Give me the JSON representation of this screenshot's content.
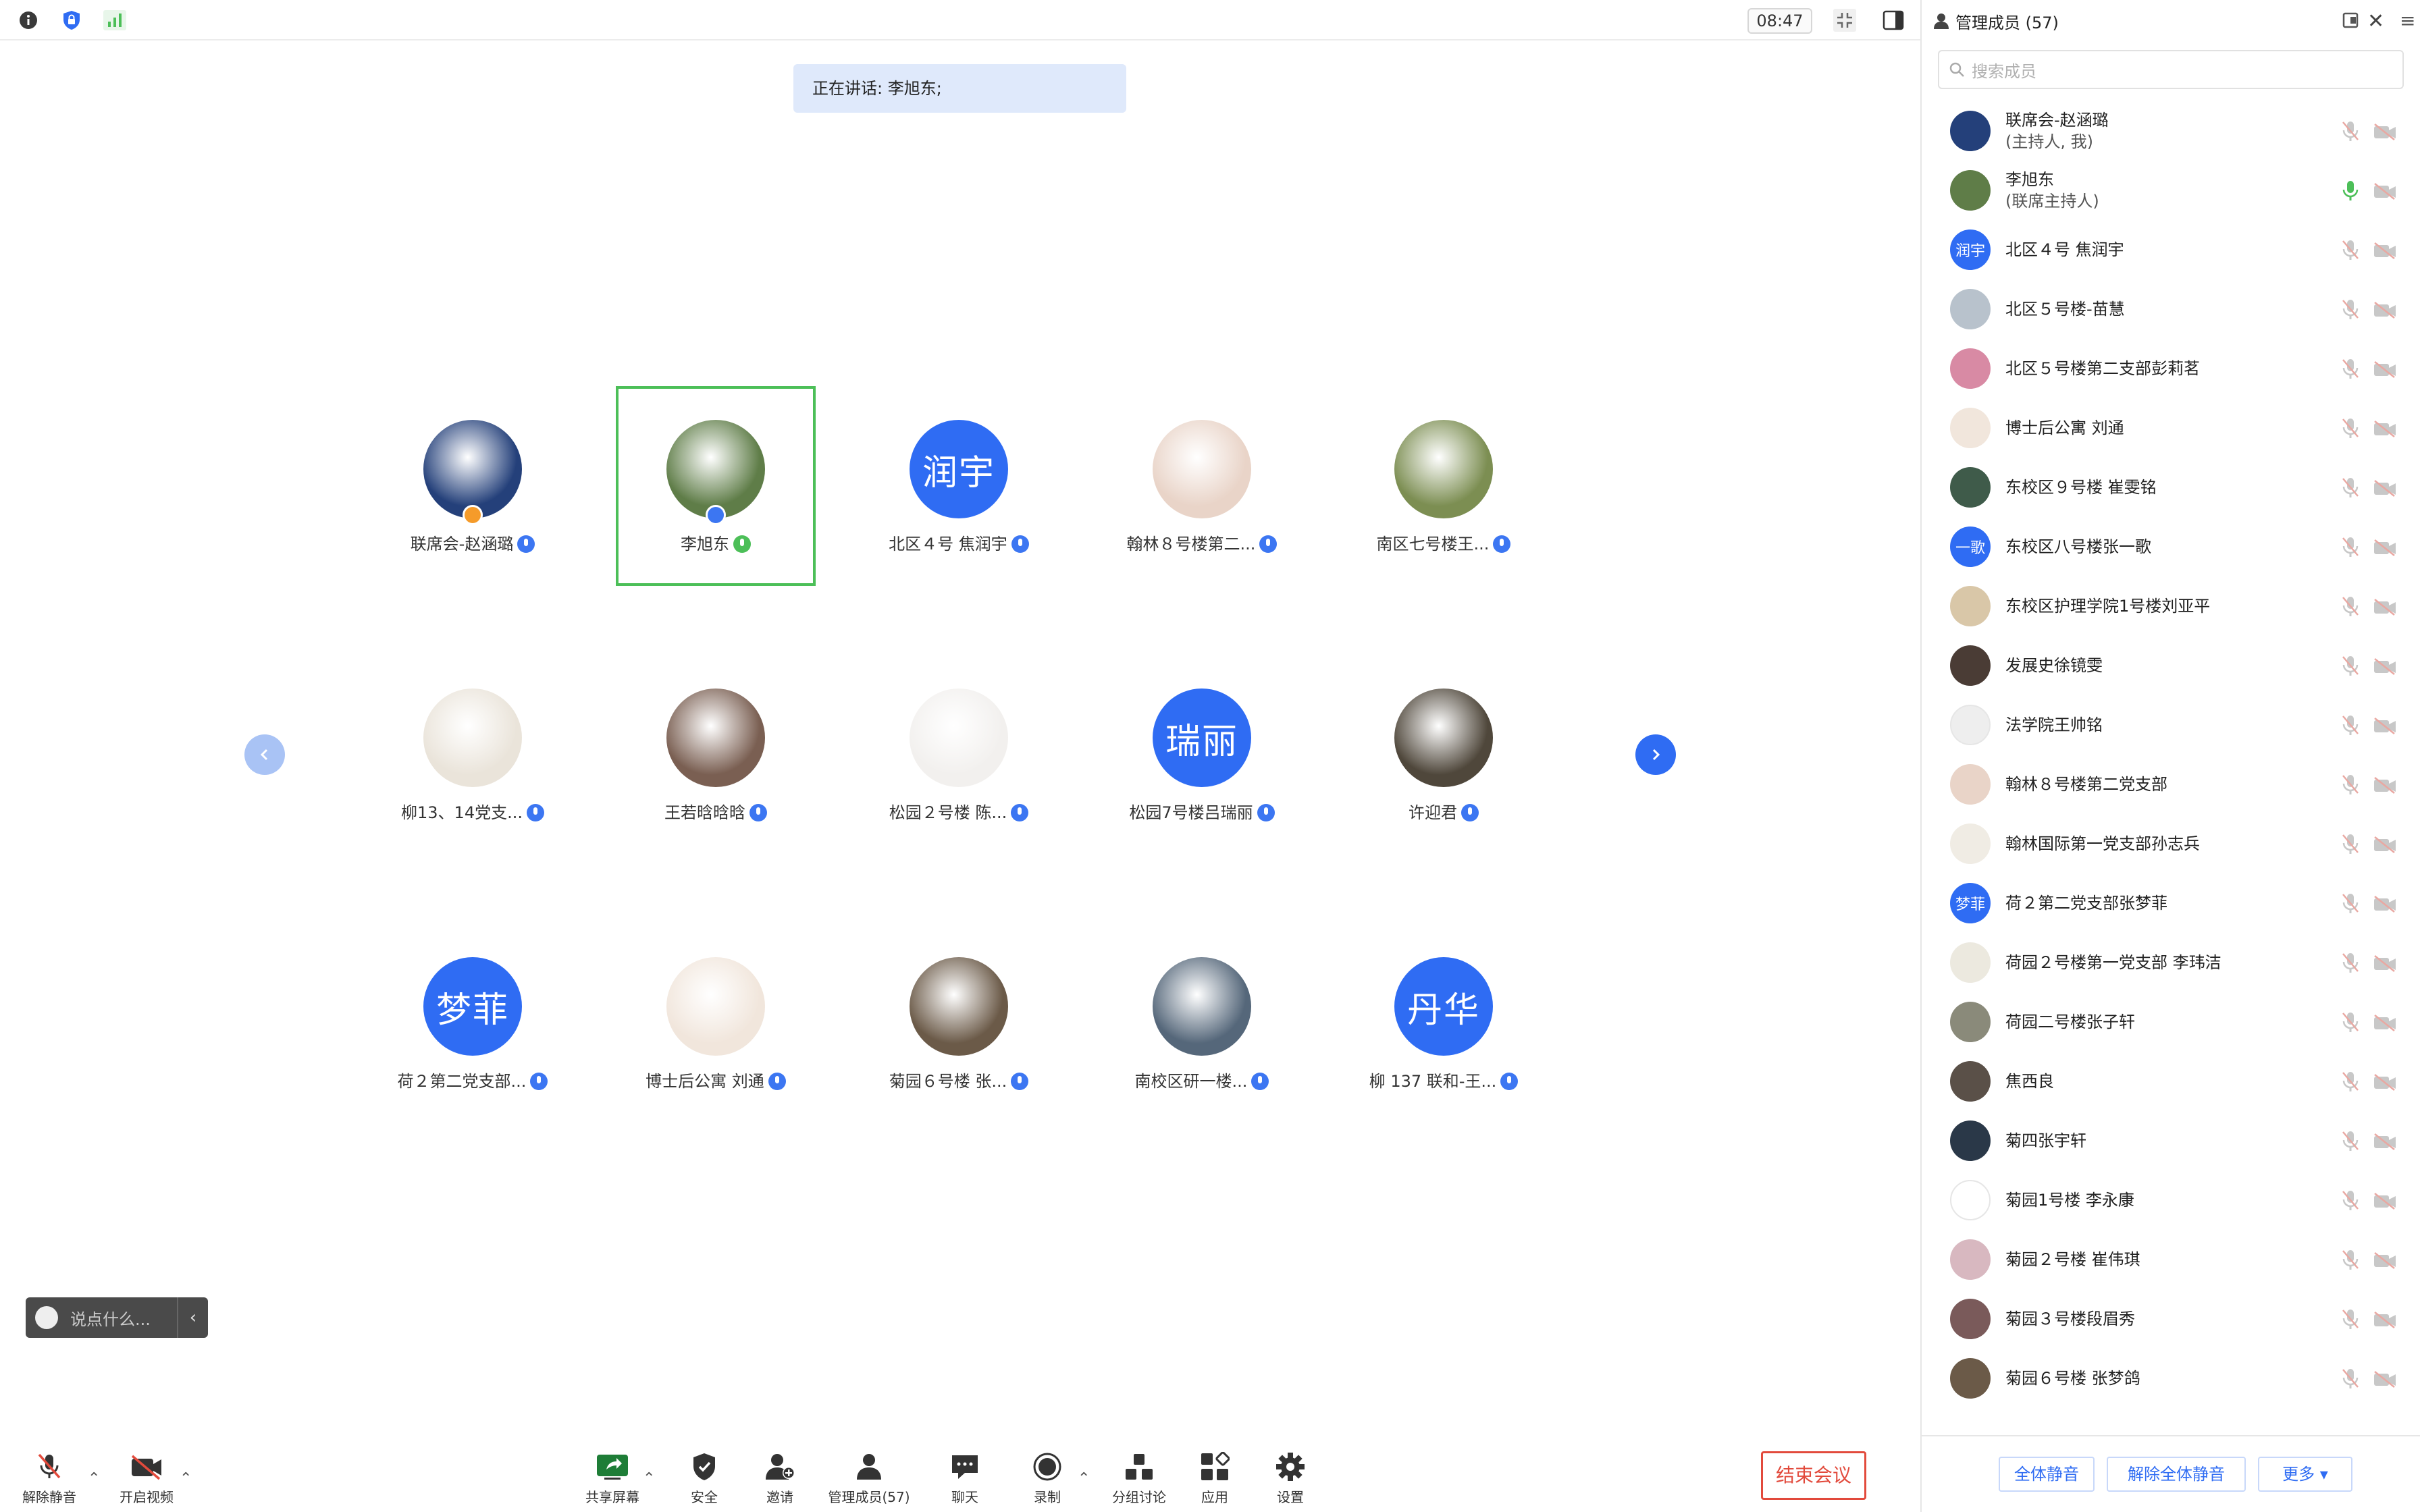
{
  "clock": "08:47",
  "speaking": "正在讲话: 李旭东;",
  "chat_placeholder": "说点什么...",
  "grid": [
    {
      "name": "联席会-赵涵璐",
      "avatar_color": "#24407a"
    },
    {
      "name": "李旭东",
      "avatar_color": "#5f7d48"
    },
    {
      "name": "北区４号 焦润宇",
      "avatar_text": "润宇"
    },
    {
      "name": "翰林８号楼第二...",
      "avatar_color": "#e9d4c8"
    },
    {
      "name": "南区七号楼王...",
      "avatar_color": "#7c8e52"
    },
    {
      "name": "柳13、14党支...",
      "avatar_color": "#eae4da"
    },
    {
      "name": "王若晗晗晗",
      "avatar_color": "#7a5f52"
    },
    {
      "name": "松园２号楼 陈...",
      "avatar_color": "#f2f0ee"
    },
    {
      "name": "松园7号楼吕瑞丽",
      "avatar_text": "瑞丽"
    },
    {
      "name": "许迎君",
      "avatar_color": "#4f473b"
    },
    {
      "name": "荷２第二党支部...",
      "avatar_text": "梦菲"
    },
    {
      "name": "博士后公寓 刘通",
      "avatar_color": "#f1e6dc"
    },
    {
      "name": "菊园６号楼 张...",
      "avatar_color": "#6b5a48"
    },
    {
      "name": "南校区研一楼...",
      "avatar_color": "#55677a"
    },
    {
      "name": "柳 137 联和-王...",
      "avatar_text": "丹华"
    }
  ],
  "toolbar": {
    "unmute": "解除静音",
    "video": "开启视频",
    "share": "共享屏幕",
    "security": "安全",
    "invite": "邀请",
    "members": "管理成员(57)",
    "chat": "聊天",
    "record": "录制",
    "breakout": "分组讨论",
    "apps": "应用",
    "settings": "设置",
    "end": "结束会议"
  },
  "sidebar": {
    "title": "管理成员 (57)",
    "search_placeholder": "搜索成员",
    "members": [
      {
        "name": "联席会-赵涵璐",
        "sub": "(主持人, 我)",
        "avatar_color": "#24407a",
        "mic": "muted"
      },
      {
        "name": "李旭东",
        "sub": "(联席主持人)",
        "avatar_color": "#5f7d48",
        "mic": "on"
      },
      {
        "name": "北区４号 焦润宇",
        "avatar_text": "润宇",
        "mic": "muted"
      },
      {
        "name": "北区５号楼-苗慧",
        "avatar_color": "#b8c2cc",
        "mic": "muted"
      },
      {
        "name": "北区５号楼第二支部彭莉茗",
        "avatar_color": "#d88aa4",
        "mic": "muted"
      },
      {
        "name": "博士后公寓 刘通",
        "avatar_color": "#f1e6dc",
        "mic": "muted"
      },
      {
        "name": "东校区９号楼 崔雯铭",
        "avatar_color": "#3f5b4a",
        "mic": "muted"
      },
      {
        "name": "东校区八号楼张一歌",
        "avatar_text": "一歌",
        "mic": "muted"
      },
      {
        "name": "东校区护理学院1号楼刘亚平",
        "avatar_color": "#d9c7a8",
        "mic": "muted"
      },
      {
        "name": "发展史徐镜雯",
        "avatar_color": "#4a3c35",
        "mic": "muted"
      },
      {
        "name": "法学院王帅铭",
        "avatar_color": "#eeeeee",
        "mic": "muted"
      },
      {
        "name": "翰林８号楼第二党支部",
        "avatar_color": "#e9d4c8",
        "mic": "muted"
      },
      {
        "name": "翰林国际第一党支部孙志兵",
        "avatar_color": "#f0ece4",
        "mic": "muted"
      },
      {
        "name": "荷２第二党支部张梦菲",
        "avatar_text": "梦菲",
        "mic": "muted"
      },
      {
        "name": "荷园２号楼第一党支部 李玮洁",
        "avatar_color": "#ece9df",
        "mic": "muted"
      },
      {
        "name": "荷园二号楼张子轩",
        "avatar_color": "#8a8a7a",
        "mic": "muted"
      },
      {
        "name": "焦西良",
        "avatar_color": "#5a5048",
        "mic": "muted"
      },
      {
        "name": "菊四张宇轩",
        "avatar_color": "#2a3848",
        "mic": "muted"
      },
      {
        "name": "菊园1号楼 李永康",
        "avatar_color": "#ffffff",
        "mic": "muted"
      },
      {
        "name": "菊园２号楼 崔伟琪",
        "avatar_color": "#d8b8c0",
        "mic": "muted"
      },
      {
        "name": "菊园３号楼段眉秀",
        "avatar_color": "#7a5a5a",
        "mic": "muted"
      },
      {
        "name": "菊园６号楼 张梦鸽",
        "avatar_color": "#6b5a48",
        "mic": "muted"
      }
    ],
    "mute_all": "全体静音",
    "unmute_all": "解除全体静音",
    "more": "更多 ▾"
  },
  "colors": {
    "accent": "#2f6cf3",
    "active_border": "#4cbf58",
    "end": "#e24a3c"
  }
}
